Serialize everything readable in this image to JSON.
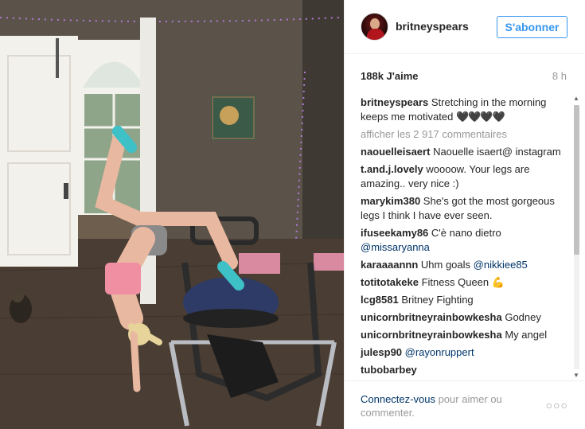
{
  "post": {
    "username": "britneyspears",
    "follow_label": "S'abonner",
    "likes": "188k J'aime",
    "time": "8 h"
  },
  "comments": [
    {
      "user": "britneyspears",
      "text": "Stretching in the morning keeps me motivated",
      "hearts": "🖤🖤🖤🖤"
    },
    {
      "view_all": "afficher les 2 917 commentaires"
    },
    {
      "user": "naouelleisaert",
      "text": "Naouelle isaert@ instagram"
    },
    {
      "user": "t.and.j.lovely",
      "text": "woooow. Your legs are amazing.. very nice :)"
    },
    {
      "user": "marykim380",
      "text": "She's got the most gorgeous legs I think I have ever seen."
    },
    {
      "user": "ifuseekamy86",
      "text": "C'è nano dietro",
      "mention": "@missaryanna"
    },
    {
      "user": "karaaaannn",
      "text": "Uhm goals",
      "mention": "@nikkiee85"
    },
    {
      "user": "totitotakeke",
      "text": "Fitness Queen",
      "emoji": "💪"
    },
    {
      "user": "lcg8581",
      "text": "Britney Fighting"
    },
    {
      "user": "unicornbritneyrainbowkesha",
      "text": "Godney"
    },
    {
      "user": "unicornbritneyrainbowkesha",
      "text": "My angel"
    },
    {
      "user": "julesp90",
      "mention": "@rayonruppert"
    },
    {
      "user": "tubobarbey",
      "text": ""
    }
  ],
  "footer": {
    "login_link": "Connectez-vous",
    "rest": "pour aimer ou commenter.",
    "more": "○○○"
  },
  "icons": {
    "scroll_up": "▲",
    "scroll_down": "▼"
  }
}
